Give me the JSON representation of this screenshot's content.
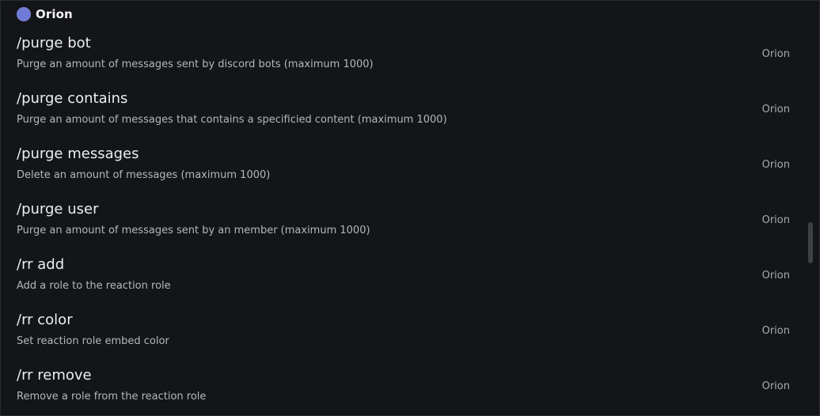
{
  "group": {
    "name": "Orion",
    "avatar_color": "#6f7bd6"
  },
  "commands": [
    {
      "name": "/purge bot",
      "description": "Purge an amount of messages sent by discord bots (maximum 1000)",
      "source": "Orion"
    },
    {
      "name": "/purge contains",
      "description": "Purge an amount of messages that contains a specificied content (maximum 1000)",
      "source": "Orion"
    },
    {
      "name": "/purge messages",
      "description": "Delete an amount of messages (maximum 1000)",
      "source": "Orion"
    },
    {
      "name": "/purge user",
      "description": "Purge an amount of messages sent by an member (maximum 1000)",
      "source": "Orion"
    },
    {
      "name": "/rr add",
      "description": "Add a role to the reaction role",
      "source": "Orion"
    },
    {
      "name": "/rr color",
      "description": "Set reaction role embed color",
      "source": "Orion"
    },
    {
      "name": "/rr remove",
      "description": "Remove a role from the reaction role",
      "source": "Orion"
    }
  ],
  "colors": {
    "background": "#141518",
    "text_primary": "#eceef1",
    "text_secondary": "#b4b7bd"
  }
}
